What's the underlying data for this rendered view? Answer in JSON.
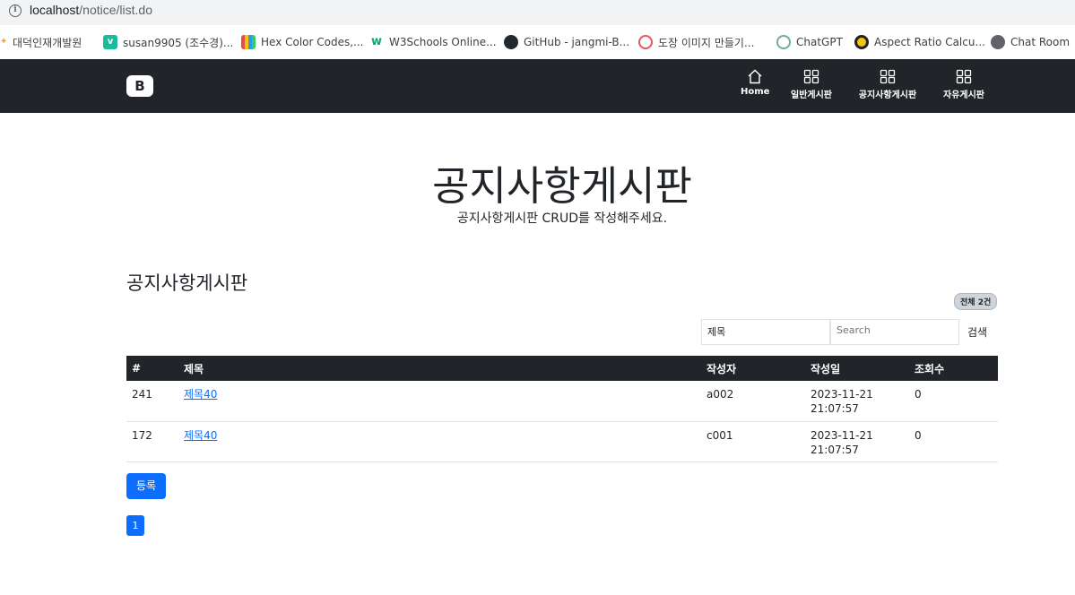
{
  "browser": {
    "url_host": "localhost",
    "url_path": "/notice/list.do",
    "bookmarks": [
      {
        "label": "대덕인재개발원",
        "icon": "brand-flame-icon",
        "color": "#f4a236"
      },
      {
        "label": "susan9905 (조수경)...",
        "icon": "v-logo-icon",
        "color": "#1abc9c"
      },
      {
        "label": "Hex Color Codes,...",
        "icon": "color-book-icon",
        "color": "#e74c3c"
      },
      {
        "label": "W3Schools Online...",
        "icon": "w3schools-icon",
        "color": "#04aa6d"
      },
      {
        "label": "GitHub - jangmi-B...",
        "icon": "github-icon",
        "color": "#24292f"
      },
      {
        "label": "도장 이미지 만들기...",
        "icon": "stamp-icon",
        "color": "#e05a5a"
      },
      {
        "label": "ChatGPT",
        "icon": "chatgpt-icon",
        "color": "#74aa9c"
      },
      {
        "label": "Aspect Ratio Calcu...",
        "icon": "aspect-ratio-icon",
        "color": "#f1c40f"
      },
      {
        "label": "Chat Room",
        "icon": "globe-icon",
        "color": "#5f6368"
      }
    ]
  },
  "navbar": {
    "brand": "B",
    "items": [
      {
        "label": "Home",
        "icon": "house-icon"
      },
      {
        "label": "일반게시판",
        "icon": "grid-icon"
      },
      {
        "label": "공지사항게시판",
        "icon": "grid-icon"
      },
      {
        "label": "자유게시판",
        "icon": "grid-icon"
      }
    ]
  },
  "hero": {
    "title": "공지사항게시판",
    "subtitle": "공지사항게시판 CRUD를 작성해주세요."
  },
  "board": {
    "title": "공지사항게시판",
    "total_badge": "전체 2건",
    "search_field": "제목",
    "search_placeholder": "Search",
    "search_button": "검색",
    "columns": [
      "#",
      "제목",
      "작성자",
      "작성일",
      "조회수"
    ],
    "rows": [
      {
        "no": "241",
        "title": "제목40",
        "writer": "a002",
        "date": "2023-11-21",
        "time": "21:07:57",
        "hit": "0"
      },
      {
        "no": "172",
        "title": "제목40",
        "writer": "c001",
        "date": "2023-11-21",
        "time": "21:07:57",
        "hit": "0"
      }
    ],
    "register_button": "등록",
    "pages": [
      "1"
    ]
  },
  "colors": {
    "navbar_bg": "#212529",
    "primary": "#0d6efd"
  }
}
